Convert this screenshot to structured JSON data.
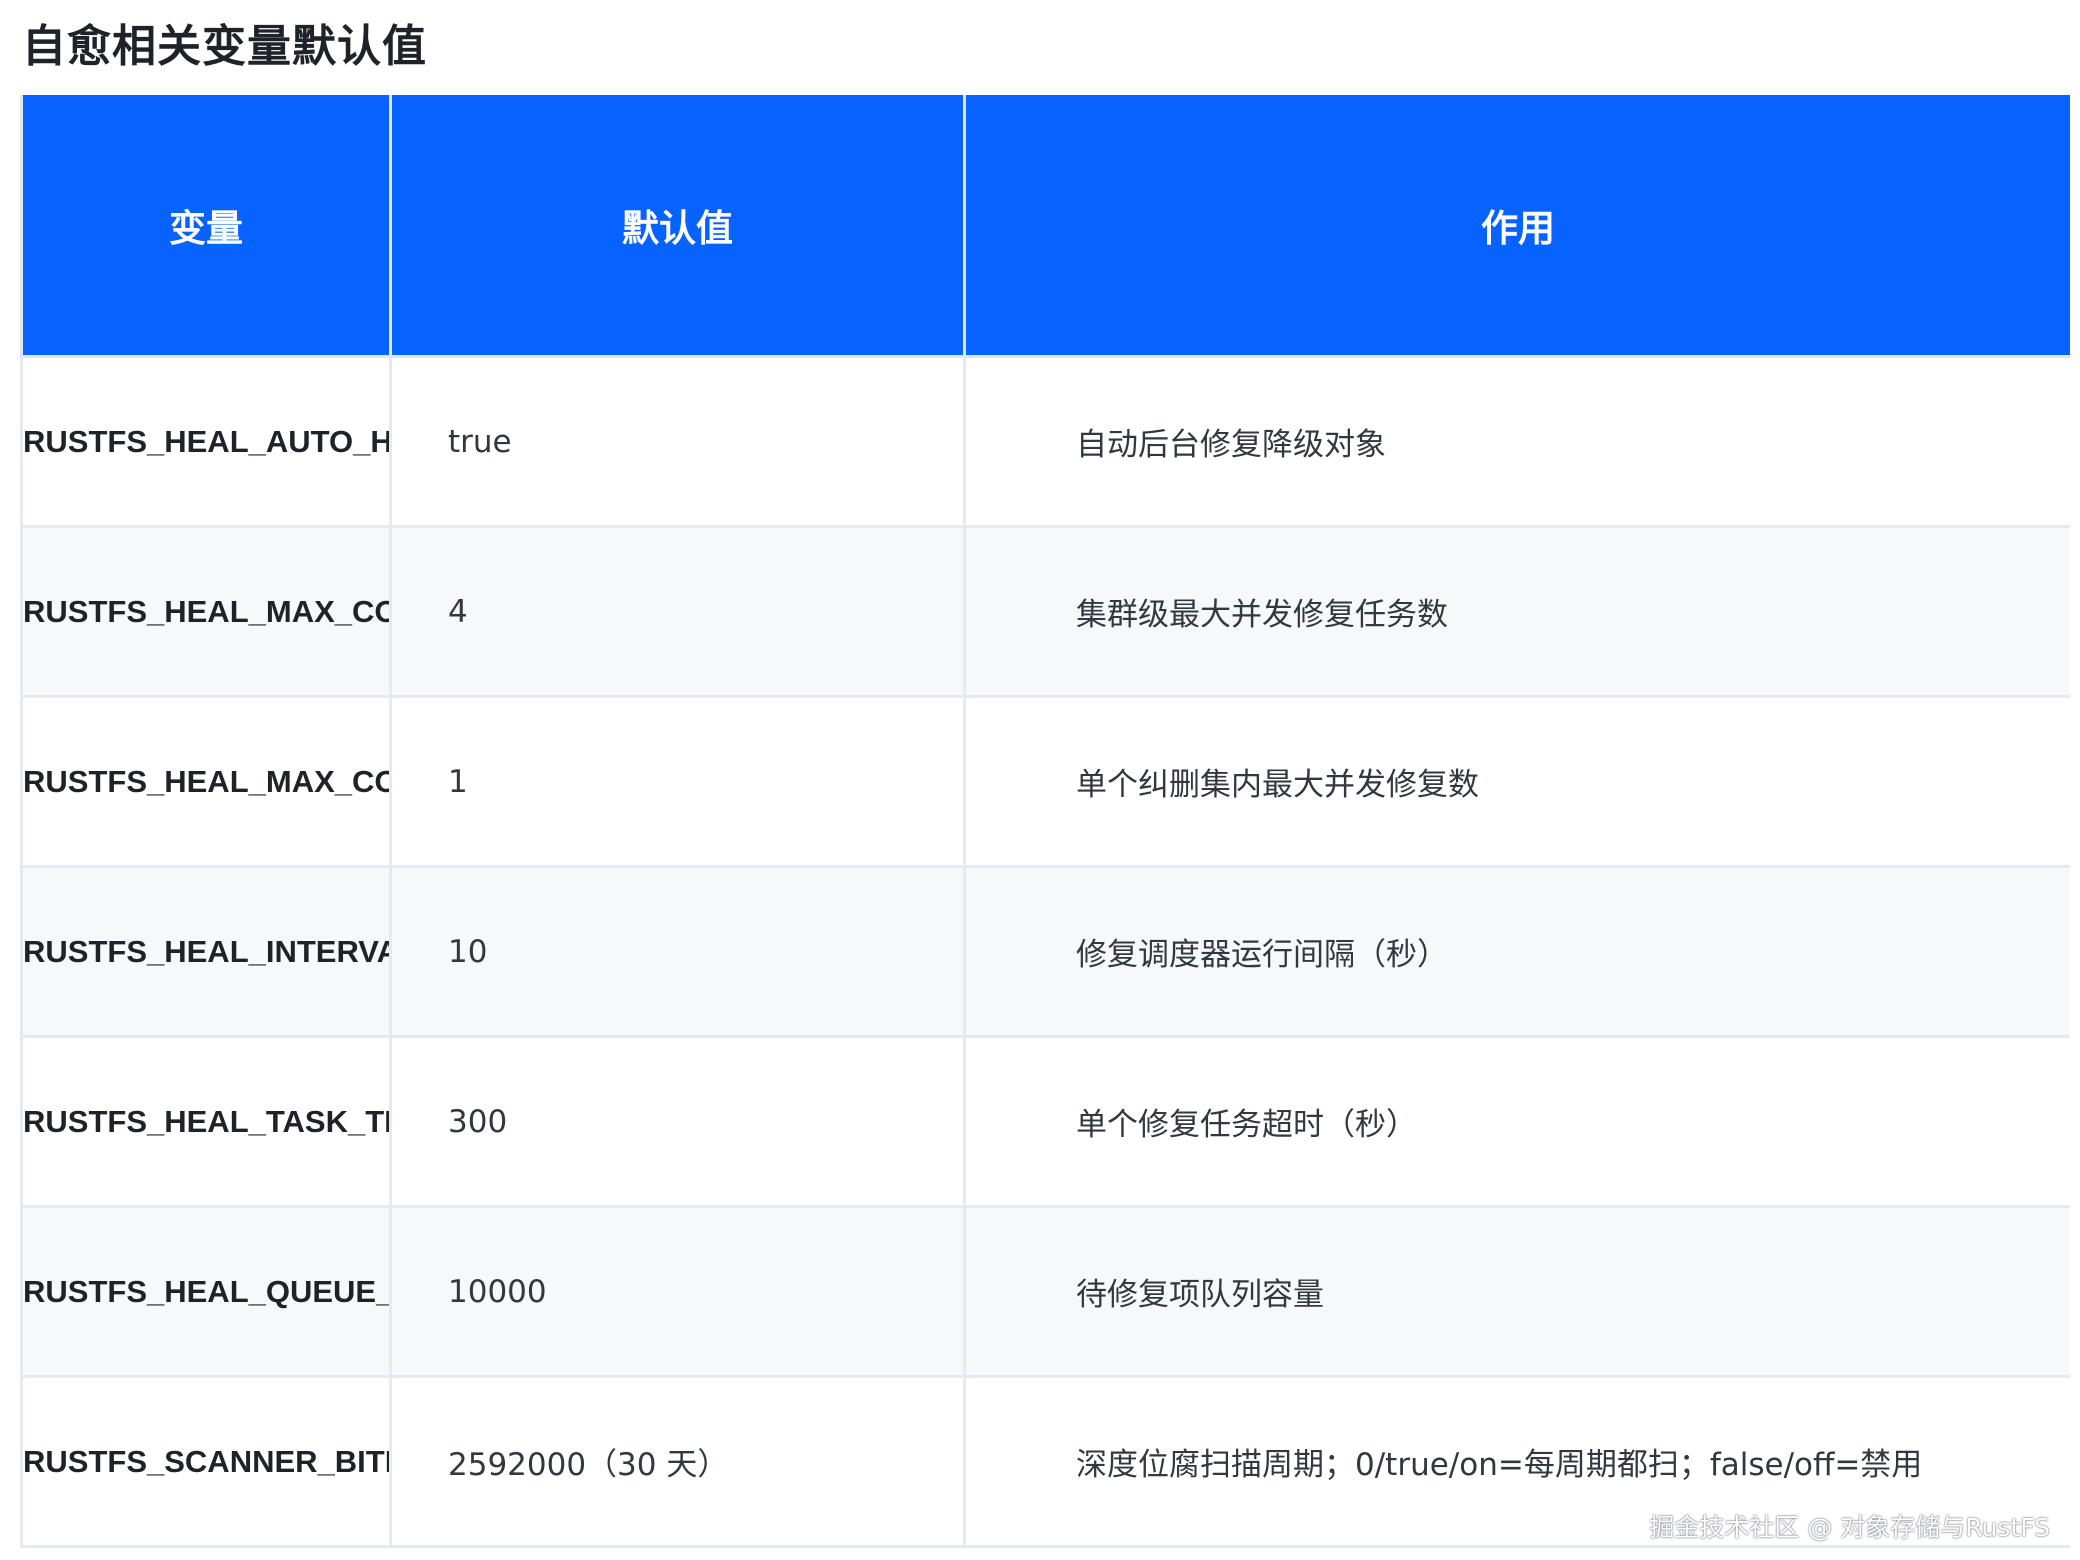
{
  "heading": "自愈相关变量默认值",
  "table": {
    "headers": [
      "变量",
      "默认值",
      "作用"
    ],
    "rows": [
      {
        "var": "RUSTFS_HEAL_AUTO_HEAL_ENABLE",
        "default": "true",
        "desc": "自动后台修复降级对象"
      },
      {
        "var": "RUSTFS_HEAL_MAX_CONCURRENT_HEALS",
        "default": "4",
        "desc": "集群级最大并发修复任务数"
      },
      {
        "var": "RUSTFS_HEAL_MAX_CONCURRENT_DISK",
        "default": "1",
        "desc": "单个纠删集内最大并发修复数"
      },
      {
        "var": "RUSTFS_HEAL_INTERVAL_SECS",
        "default": "10",
        "desc": "修复调度器运行间隔（秒）"
      },
      {
        "var": "RUSTFS_HEAL_TASK_TIMEOUT_SECS",
        "default": "300",
        "desc": "单个修复任务超时（秒）"
      },
      {
        "var": "RUSTFS_HEAL_QUEUE_SIZE",
        "default": "10000",
        "desc": "待修复项队列容量"
      },
      {
        "var": "RUSTFS_SCANNER_BITROT_CYCLE",
        "default": "2592000（30 天）",
        "desc": "深度位腐扫描周期；0/true/on=每周期都扫；false/off=禁用"
      }
    ]
  },
  "watermark": "掘金技术社区 @ 对象存储与RustFS"
}
